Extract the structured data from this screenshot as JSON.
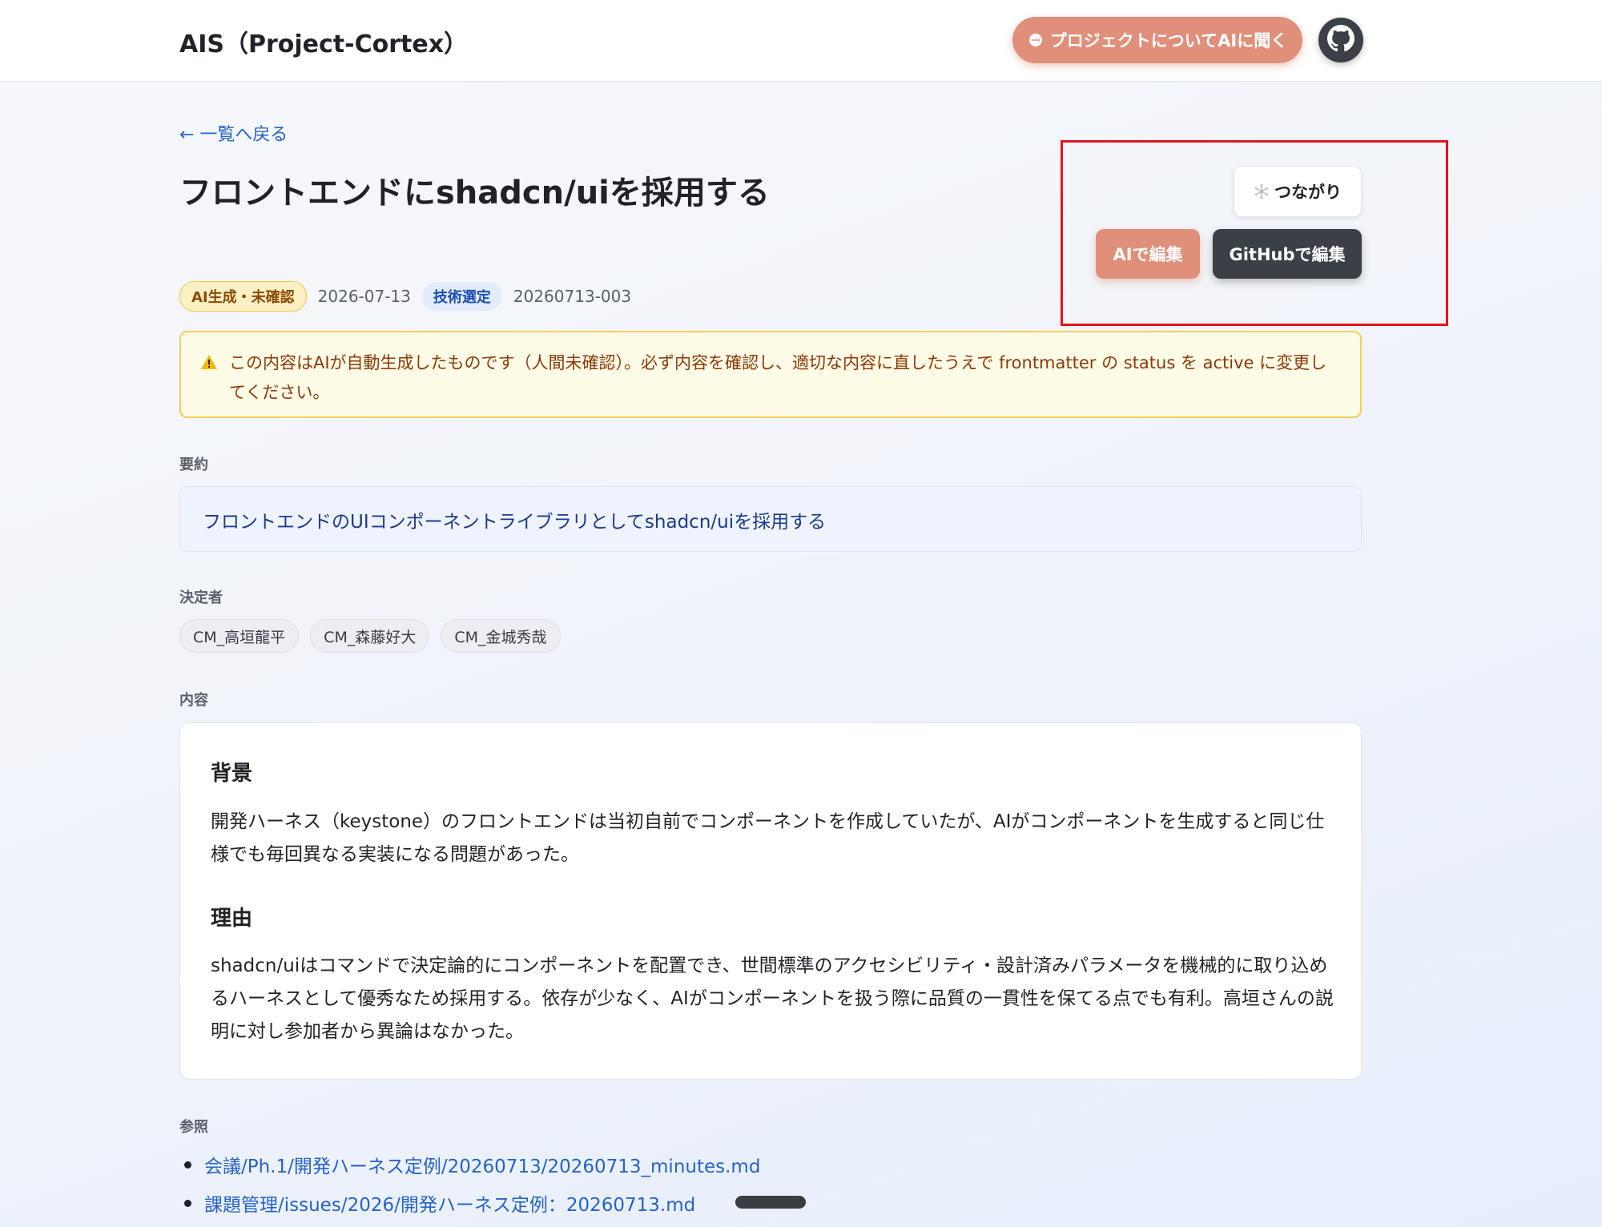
{
  "header": {
    "app_title": "AIS（Project-Cortex）",
    "ask_ai_label": "プロジェクトについてAIに聞く",
    "github_icon": "github-icon"
  },
  "nav": {
    "back_label": "← 一覧へ戻る"
  },
  "page": {
    "title": "フロントエンドにshadcn/uiを採用する"
  },
  "actions": {
    "links_label": "つながり",
    "ai_edit_label": "AIで編集",
    "github_edit_label": "GitHubで編集"
  },
  "meta": {
    "status_badge": "AI生成・未確認",
    "date": "2026-07-13",
    "category_badge": "技術選定",
    "id": "20260713-003"
  },
  "warning": {
    "text": "この内容はAIが自動生成したものです（人間未確認）。必ず内容を確認し、適切な内容に直したうえで frontmatter の status を active に変更してください。"
  },
  "summary": {
    "label": "要約",
    "text": "フロントエンドのUIコンポーネントライブラリとしてshadcn/uiを採用する"
  },
  "deciders": {
    "label": "決定者",
    "people": [
      "CM_高垣龍平",
      "CM_森藤好大",
      "CM_金城秀哉"
    ]
  },
  "content": {
    "label": "内容",
    "sections": [
      {
        "heading": "背景",
        "body": "開発ハーネス（keystone）のフロントエンドは当初自前でコンポーネントを作成していたが、AIがコンポーネントを生成すると同じ仕様でも毎回異なる実装になる問題があった。"
      },
      {
        "heading": "理由",
        "body": "shadcn/uiはコマンドで決定論的にコンポーネントを配置でき、世間標準のアクセシビリティ・設計済みパラメータを機械的に取り込めるハーネスとして優秀なため採用する。依存が少なく、AIがコンポーネントを扱う際に品質の一貫性を保てる点でも有利。高垣さんの説明に対し参加者から異論はなかった。"
      }
    ]
  },
  "references": {
    "label": "参照",
    "items": [
      "会議/Ph.1/開発ハーネス定例/20260713/20260713_minutes.md",
      "課題管理/issues/2026/開発ハーネス定例：20260713.md"
    ]
  },
  "colors": {
    "accent": "#e0907a",
    "dark_button": "#3b3f46",
    "link": "#2563c9",
    "warning_bg": "#fefbe6",
    "highlight": "#e0161b"
  }
}
